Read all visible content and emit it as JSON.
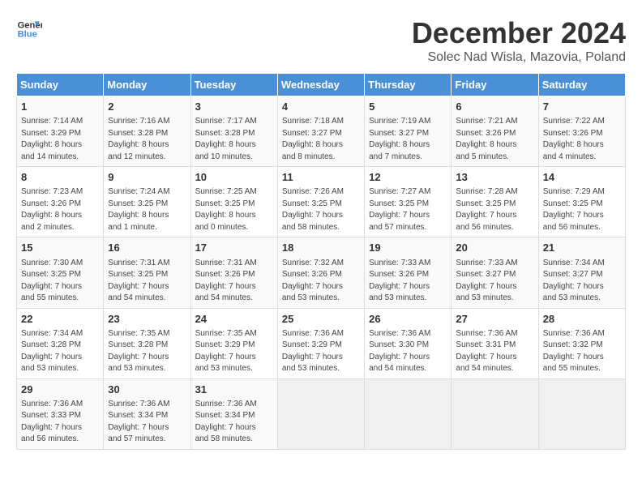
{
  "header": {
    "logo_general": "General",
    "logo_blue": "Blue",
    "main_title": "December 2024",
    "subtitle": "Solec Nad Wisla, Mazovia, Poland"
  },
  "calendar": {
    "days_of_week": [
      "Sunday",
      "Monday",
      "Tuesday",
      "Wednesday",
      "Thursday",
      "Friday",
      "Saturday"
    ],
    "weeks": [
      [
        {
          "day": "",
          "info": ""
        },
        {
          "day": "2",
          "info": "Sunrise: 7:16 AM\nSunset: 3:28 PM\nDaylight: 8 hours\nand 12 minutes."
        },
        {
          "day": "3",
          "info": "Sunrise: 7:17 AM\nSunset: 3:28 PM\nDaylight: 8 hours\nand 10 minutes."
        },
        {
          "day": "4",
          "info": "Sunrise: 7:18 AM\nSunset: 3:27 PM\nDaylight: 8 hours\nand 8 minutes."
        },
        {
          "day": "5",
          "info": "Sunrise: 7:19 AM\nSunset: 3:27 PM\nDaylight: 8 hours\nand 7 minutes."
        },
        {
          "day": "6",
          "info": "Sunrise: 7:21 AM\nSunset: 3:26 PM\nDaylight: 8 hours\nand 5 minutes."
        },
        {
          "day": "7",
          "info": "Sunrise: 7:22 AM\nSunset: 3:26 PM\nDaylight: 8 hours\nand 4 minutes."
        }
      ],
      [
        {
          "day": "1",
          "info": "Sunrise: 7:14 AM\nSunset: 3:29 PM\nDaylight: 8 hours\nand 14 minutes."
        },
        {
          "day": "",
          "info": ""
        },
        {
          "day": "",
          "info": ""
        },
        {
          "day": "",
          "info": ""
        },
        {
          "day": "",
          "info": ""
        },
        {
          "day": "",
          "info": ""
        },
        {
          "day": "",
          "info": ""
        }
      ],
      [
        {
          "day": "8",
          "info": "Sunrise: 7:23 AM\nSunset: 3:26 PM\nDaylight: 8 hours\nand 2 minutes."
        },
        {
          "day": "9",
          "info": "Sunrise: 7:24 AM\nSunset: 3:25 PM\nDaylight: 8 hours\nand 1 minute."
        },
        {
          "day": "10",
          "info": "Sunrise: 7:25 AM\nSunset: 3:25 PM\nDaylight: 8 hours\nand 0 minutes."
        },
        {
          "day": "11",
          "info": "Sunrise: 7:26 AM\nSunset: 3:25 PM\nDaylight: 7 hours\nand 58 minutes."
        },
        {
          "day": "12",
          "info": "Sunrise: 7:27 AM\nSunset: 3:25 PM\nDaylight: 7 hours\nand 57 minutes."
        },
        {
          "day": "13",
          "info": "Sunrise: 7:28 AM\nSunset: 3:25 PM\nDaylight: 7 hours\nand 56 minutes."
        },
        {
          "day": "14",
          "info": "Sunrise: 7:29 AM\nSunset: 3:25 PM\nDaylight: 7 hours\nand 56 minutes."
        }
      ],
      [
        {
          "day": "15",
          "info": "Sunrise: 7:30 AM\nSunset: 3:25 PM\nDaylight: 7 hours\nand 55 minutes."
        },
        {
          "day": "16",
          "info": "Sunrise: 7:31 AM\nSunset: 3:25 PM\nDaylight: 7 hours\nand 54 minutes."
        },
        {
          "day": "17",
          "info": "Sunrise: 7:31 AM\nSunset: 3:26 PM\nDaylight: 7 hours\nand 54 minutes."
        },
        {
          "day": "18",
          "info": "Sunrise: 7:32 AM\nSunset: 3:26 PM\nDaylight: 7 hours\nand 53 minutes."
        },
        {
          "day": "19",
          "info": "Sunrise: 7:33 AM\nSunset: 3:26 PM\nDaylight: 7 hours\nand 53 minutes."
        },
        {
          "day": "20",
          "info": "Sunrise: 7:33 AM\nSunset: 3:27 PM\nDaylight: 7 hours\nand 53 minutes."
        },
        {
          "day": "21",
          "info": "Sunrise: 7:34 AM\nSunset: 3:27 PM\nDaylight: 7 hours\nand 53 minutes."
        }
      ],
      [
        {
          "day": "22",
          "info": "Sunrise: 7:34 AM\nSunset: 3:28 PM\nDaylight: 7 hours\nand 53 minutes."
        },
        {
          "day": "23",
          "info": "Sunrise: 7:35 AM\nSunset: 3:28 PM\nDaylight: 7 hours\nand 53 minutes."
        },
        {
          "day": "24",
          "info": "Sunrise: 7:35 AM\nSunset: 3:29 PM\nDaylight: 7 hours\nand 53 minutes."
        },
        {
          "day": "25",
          "info": "Sunrise: 7:36 AM\nSunset: 3:29 PM\nDaylight: 7 hours\nand 53 minutes."
        },
        {
          "day": "26",
          "info": "Sunrise: 7:36 AM\nSunset: 3:30 PM\nDaylight: 7 hours\nand 54 minutes."
        },
        {
          "day": "27",
          "info": "Sunrise: 7:36 AM\nSunset: 3:31 PM\nDaylight: 7 hours\nand 54 minutes."
        },
        {
          "day": "28",
          "info": "Sunrise: 7:36 AM\nSunset: 3:32 PM\nDaylight: 7 hours\nand 55 minutes."
        }
      ],
      [
        {
          "day": "29",
          "info": "Sunrise: 7:36 AM\nSunset: 3:33 PM\nDaylight: 7 hours\nand 56 minutes."
        },
        {
          "day": "30",
          "info": "Sunrise: 7:36 AM\nSunset: 3:34 PM\nDaylight: 7 hours\nand 57 minutes."
        },
        {
          "day": "31",
          "info": "Sunrise: 7:36 AM\nSunset: 3:34 PM\nDaylight: 7 hours\nand 58 minutes."
        },
        {
          "day": "",
          "info": ""
        },
        {
          "day": "",
          "info": ""
        },
        {
          "day": "",
          "info": ""
        },
        {
          "day": "",
          "info": ""
        }
      ]
    ]
  }
}
